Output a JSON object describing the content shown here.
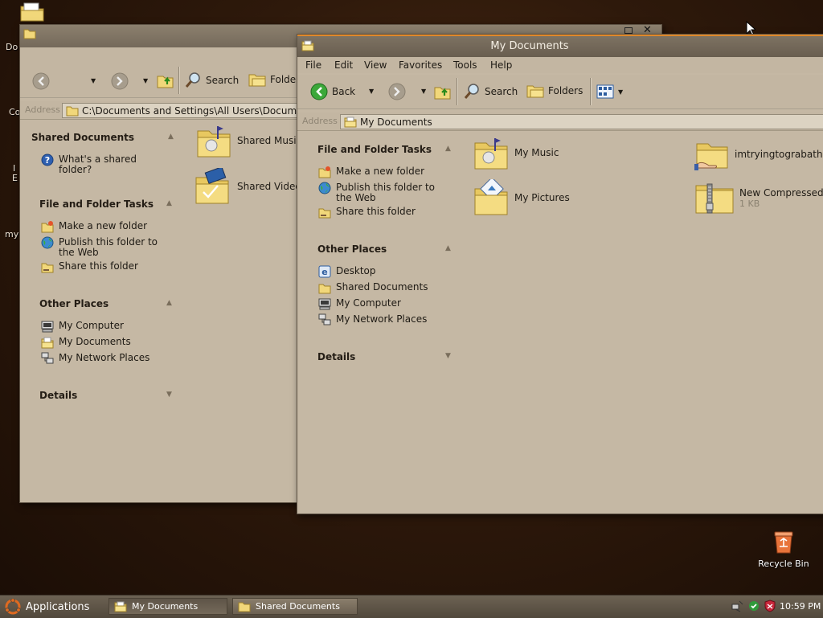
{
  "colors": {
    "desktop": "#2e190b",
    "window": "#c5b8a4",
    "titlebar_active_accent": "#e0882a",
    "taskbar": "#5f5548"
  },
  "desktop": {
    "icons": [
      {
        "label": "Recycle Bin",
        "icon": "recycle-bin-icon"
      }
    ],
    "fragments": [
      "Do",
      "Co",
      "I",
      "E",
      "my"
    ]
  },
  "window_back": {
    "title": "",
    "toolbar": {
      "search_label": "Search",
      "folders_label": "Folder"
    },
    "address": {
      "label": "Address",
      "value": "C:\\Documents and Settings\\All Users\\Documen"
    },
    "pane": {
      "sections": [
        {
          "header": "Shared Documents",
          "links": [
            {
              "label": "What's a shared folder?",
              "icon": "help-icon"
            }
          ]
        },
        {
          "header": "File and Folder Tasks",
          "links": [
            {
              "label": "Make a new folder",
              "icon": "new-folder-icon"
            },
            {
              "label": "Publish this folder to the Web",
              "icon": "globe-icon"
            },
            {
              "label": "Share this folder",
              "icon": "share-folder-icon"
            }
          ]
        },
        {
          "header": "Other Places",
          "links": [
            {
              "label": "My Computer",
              "icon": "computer-icon"
            },
            {
              "label": "My Documents",
              "icon": "documents-folder-icon"
            },
            {
              "label": "My Network Places",
              "icon": "network-icon"
            }
          ]
        },
        {
          "header": "Details",
          "links": []
        }
      ]
    },
    "files": [
      {
        "label": "Shared Music",
        "icon": "music-folder-icon"
      },
      {
        "label": "Shared Video",
        "icon": "video-folder-icon"
      }
    ]
  },
  "window_front": {
    "title": "My Documents",
    "menu": [
      "File",
      "Edit",
      "View",
      "Favorites",
      "Tools",
      "Help"
    ],
    "toolbar": {
      "back_label": "Back",
      "search_label": "Search",
      "folders_label": "Folders"
    },
    "address": {
      "label": "Address",
      "value": "My Documents"
    },
    "pane": {
      "sections": [
        {
          "header": "File and Folder Tasks",
          "links": [
            {
              "label": "Make a new folder",
              "icon": "new-folder-icon"
            },
            {
              "label": "Publish this folder to the Web",
              "icon": "globe-icon"
            },
            {
              "label": "Share this folder",
              "icon": "share-folder-icon"
            }
          ]
        },
        {
          "header": "Other Places",
          "links": [
            {
              "label": "Desktop",
              "icon": "desktop-icon"
            },
            {
              "label": "Shared Documents",
              "icon": "folder-icon"
            },
            {
              "label": "My Computer",
              "icon": "computer-icon"
            },
            {
              "label": "My Network Places",
              "icon": "network-icon"
            }
          ]
        },
        {
          "header": "Details",
          "links": []
        }
      ]
    },
    "files": [
      {
        "label": "My Music",
        "icon": "music-folder-icon"
      },
      {
        "label": "My Pictures",
        "icon": "pictures-folder-icon"
      },
      {
        "label": "imtryingtograbathe",
        "icon": "shared-folder-icon"
      },
      {
        "label": "New Compressed (",
        "sub": "1 KB",
        "icon": "zip-folder-icon"
      }
    ]
  },
  "taskbar": {
    "start_label": "Applications",
    "buttons": [
      {
        "label": "My Documents",
        "icon": "folder-icon"
      },
      {
        "label": "Shared Documents",
        "icon": "folder-icon"
      }
    ],
    "tray_icons": [
      "network-tray-icon",
      "security-tray-icon",
      "shield-tray-icon"
    ],
    "clock": "10:59 PM"
  }
}
